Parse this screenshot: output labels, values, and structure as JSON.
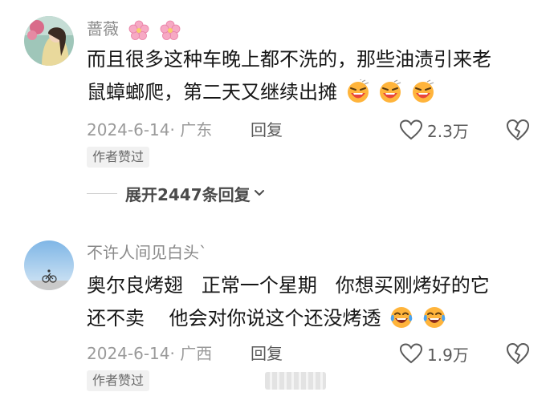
{
  "comments": [
    {
      "username": "蔷薇",
      "flower_icons": [
        "cherry-blossom-icon",
        "cherry-blossom-icon"
      ],
      "text_line1": "而且很多这种车晚上都不洗的，那些油渍引来老",
      "text_line2": "鼠蟑螂爬，第二天又继续出摊",
      "emoji_icons": [
        "laughing-face-icon",
        "laughing-face-icon",
        "laughing-face-icon"
      ],
      "meta": "2024-6-14· 广东",
      "reply_label": "回复",
      "like_count": "2.3万",
      "badge": "作者赞过"
    },
    {
      "username": "不许人间见白头`",
      "text_line1": "奥尔良烤翅   正常一个星期   你想买刚烤好的它",
      "text_line2": "还不卖    他会对你说这个还没烤透",
      "emoji_icons": [
        "crying-laughing-face-icon",
        "crying-laughing-face-icon"
      ],
      "meta": "2024-6-14· 广西",
      "reply_label": "回复",
      "like_count": "1.9万",
      "badge": "作者赞过"
    }
  ],
  "expand_replies_label": "展开2447条回复",
  "colors": {
    "text": "#161616",
    "meta": "#9a9a9a",
    "badge_bg": "#f1f1f1"
  }
}
